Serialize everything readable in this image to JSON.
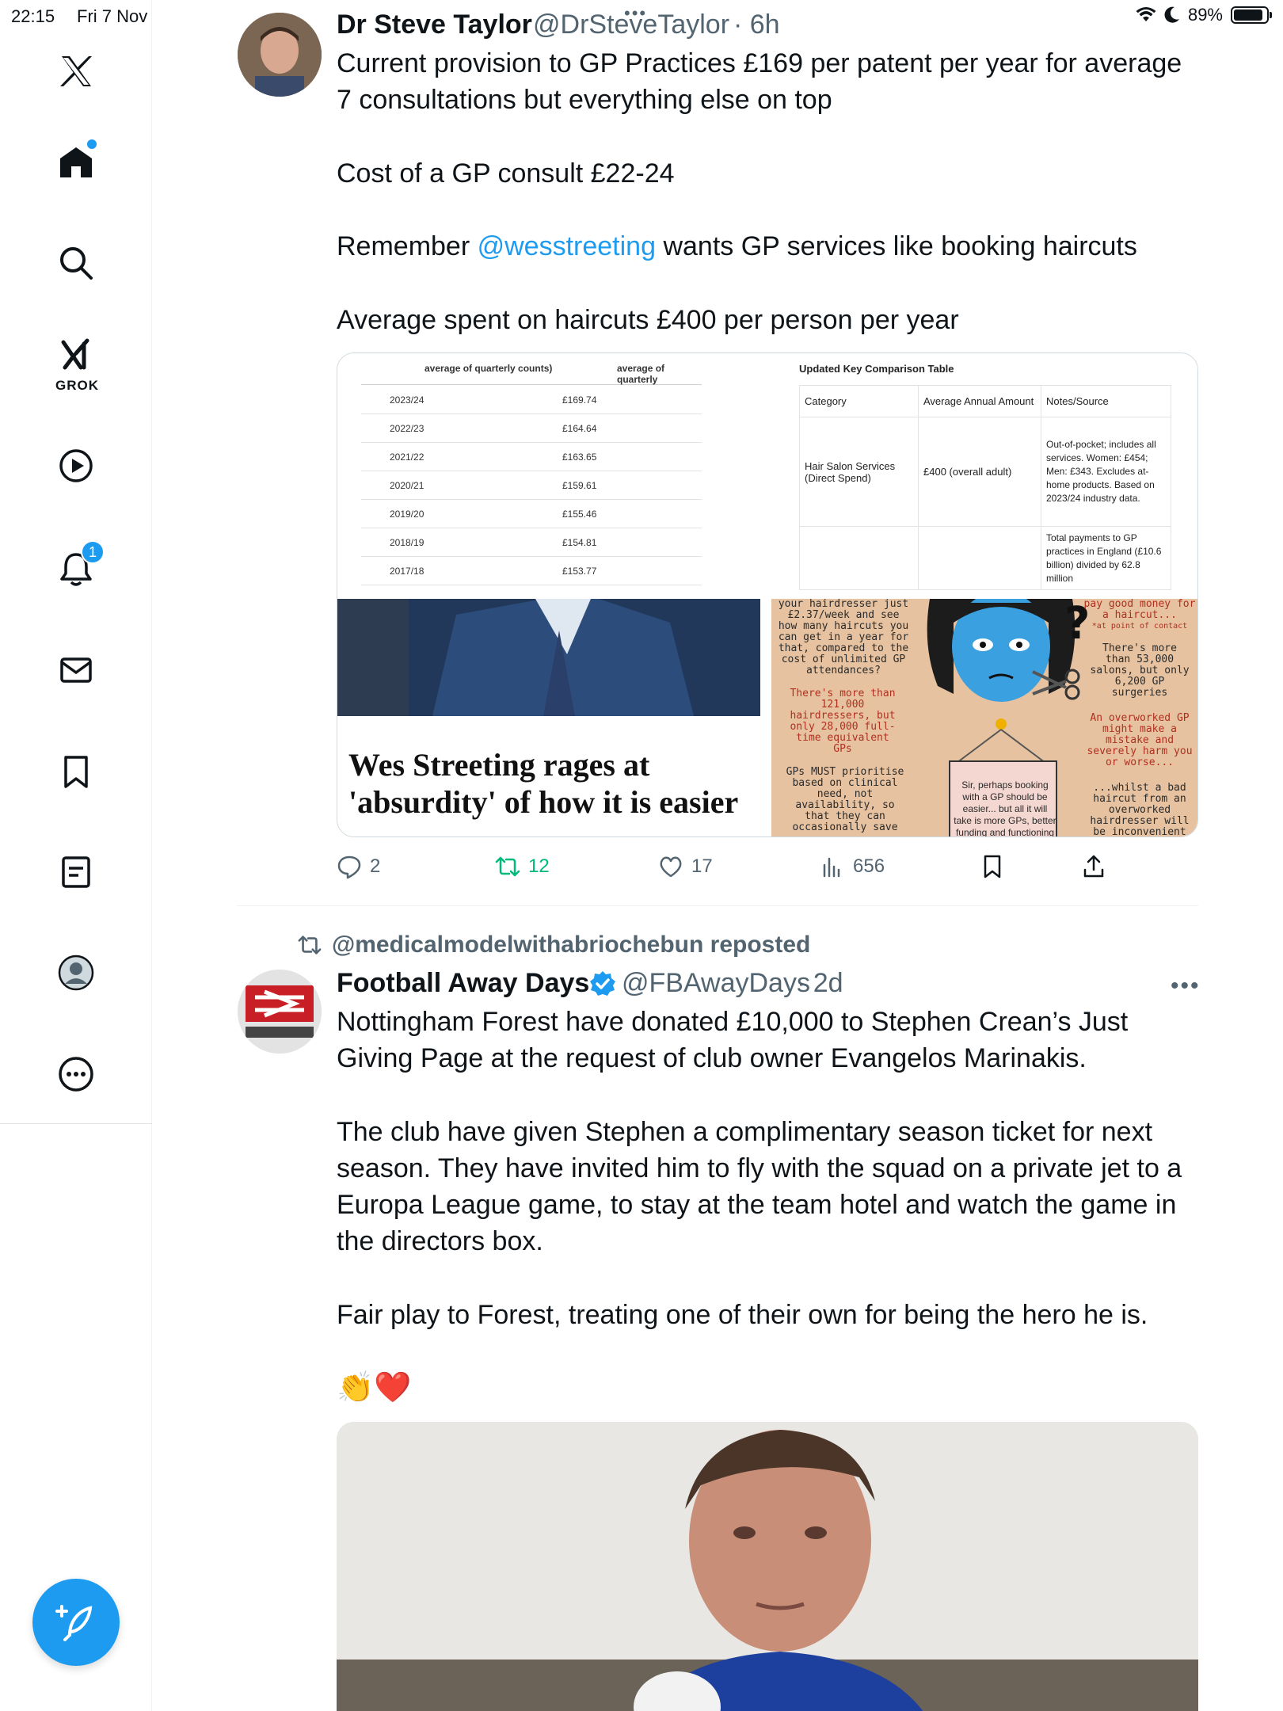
{
  "status_bar": {
    "time": "22:15",
    "date": "Fri 7 Nov",
    "battery": "89%"
  },
  "sidebar": {
    "grok_label": "GROK",
    "notifications_count": "1"
  },
  "tweet1": {
    "author": "Dr Steve Taylor",
    "handle": "@DrSteveTaylor",
    "time": "· 6h",
    "text_line1": "Current provision to GP Practices £169 per patent per year for average 7 consultations but everything else on top",
    "text_line2": "Cost of a GP consult £22-24",
    "text_remember_pre": "Remember ",
    "text_mention": "@wesstreeting",
    "text_remember_post": " wants GP services like booking haircuts",
    "text_line4": "Average spent on haircuts £400 per person per year",
    "gp_table": {
      "header_col1": "average of quarterly counts)",
      "header_col2": "average of quarterly",
      "rows": [
        {
          "year": "2023/24",
          "value": "£169.74"
        },
        {
          "year": "2022/23",
          "value": "£164.64"
        },
        {
          "year": "2021/22",
          "value": "£163.65"
        },
        {
          "year": "2020/21",
          "value": "£159.61"
        },
        {
          "year": "2019/20",
          "value": "£155.46"
        },
        {
          "year": "2018/19",
          "value": "£154.81"
        },
        {
          "year": "2017/18",
          "value": "£153.77"
        }
      ]
    },
    "comparison_table": {
      "title": "Updated Key Comparison Table",
      "h_category": "Category",
      "h_amount": "Average Annual Amount",
      "h_notes": "Notes/Source",
      "row1_category": "Hair Salon Services (Direct Spend)",
      "row1_amount": "£400 (overall adult)",
      "row1_notes": "Out-of-pocket; includes all services. Women: £454; Men: £343. Excludes at-home products. Based on 2023/24 industry data.",
      "row2_notes": "Total payments to GP practices in England (£10.6 billion) divided by 62.8 million"
    },
    "article_headline": "Wes Streeting rages at 'absurdity' of how it is easier",
    "cartoon": {
      "left_top": "your hairdresser just £2.37/week and see how many haircuts you can get in a year for that, compared to the cost of unlimited GP attendances?",
      "left_mid": "There's more than 121,000 hairdressers, but only 28,000 full-time equivalent GPs",
      "left_bottom": "GPs MUST prioritise based on clinical need, not availability, so that they can occasionally save",
      "right_top": "pay good money for a haircut...",
      "right_top_small": "*at point of contact",
      "right_mid": "There's more than 53,000 salons, but only 6,200 GP surgeries",
      "right_low": "An overworked GP might make a mistake and severely harm you or worse...",
      "right_bottom": "...whilst a bad haircut from an overworked hairdresser will be inconvenient",
      "sign": "Sir, perhaps booking with a GP should be easier... but all it will take is more GPs, better funding and functioning practices"
    },
    "actions": {
      "replies": "2",
      "reposts": "12",
      "likes": "17",
      "views": "656"
    }
  },
  "tweet2": {
    "reposted_by": "@medicalmodelwithabriochebun reposted",
    "author": "Football Away Days",
    "handle": "@FBAwayDays",
    "time": "· 2d",
    "para1": "Nottingham Forest have donated £10,000 to Stephen Crean’s Just Giving Page at the request of club owner Evangelos Marinakis.",
    "para2": "The club have given Stephen a complimentary season ticket for next season. They have invited him to fly with the squad on a private jet to a Europa League game, to stay at the team hotel and watch the game in the directors box.",
    "para3": "Fair play to Forest, treating one of their own for being the hero he is.",
    "emoji": "👏❤️"
  }
}
